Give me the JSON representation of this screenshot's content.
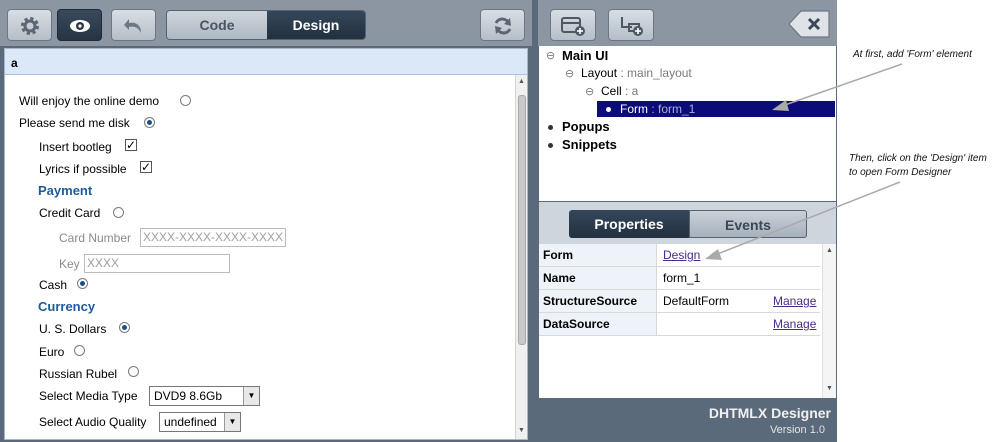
{
  "left_toolbar": {
    "tabs": {
      "code": "Code",
      "design": "Design"
    }
  },
  "cell": {
    "title": "a"
  },
  "form": {
    "enjoy_demo": "Will enjoy the online demo",
    "send_disk": "Please send me disk",
    "insert_bootleg": "Insert bootleg",
    "lyrics": "Lyrics if possible",
    "payment_header": "Payment",
    "credit_card": "Credit Card",
    "card_number_label": "Card Number",
    "card_number_placeholder": "XXXX-XXXX-XXXX-XXXX",
    "key_label": "Key",
    "key_placeholder": "XXXX",
    "cash": "Cash",
    "currency_header": "Currency",
    "usd": "U. S. Dollars",
    "euro": "Euro",
    "rubel": "Russian Rubel",
    "media_type_label": "Select Media Type",
    "media_type_value": "DVD9 8.6Gb",
    "audio_quality_label": "Select Audio Quality",
    "audio_quality_value": "undefined"
  },
  "tree": {
    "main_ui": "Main UI",
    "layout_label": "Layout",
    "layout_value": ": main_layout",
    "cell_label": "Cell",
    "cell_value": ": a",
    "form_label": "Form",
    "form_value": ": form_1",
    "popups": "Popups",
    "snippets": "Snippets"
  },
  "props_tabs": {
    "properties": "Properties",
    "events": "Events"
  },
  "properties": [
    {
      "name": "Form",
      "value": "Design",
      "manage": ""
    },
    {
      "name": "Name",
      "value": "form_1",
      "manage": ""
    },
    {
      "name": "StructureSource",
      "value": "DefaultForm",
      "manage": "Manage"
    },
    {
      "name": "DataSource",
      "value": "",
      "manage": "Manage"
    }
  ],
  "footer": {
    "title": "DHTMLX Designer",
    "version": "Version 1.0"
  },
  "annotations": {
    "note1": "At first, add 'Form' element",
    "note2_line1": "Then, click on the 'Design' item",
    "note2_line2": "to open Form Designer"
  },
  "colors": {
    "toolbar": "#8b96a2",
    "frame": "#5a6a7a",
    "selected": "#0b0b7a",
    "header_blue": "#1f5a9a"
  },
  "icons": [
    "gear-icon",
    "eye-icon",
    "undo-icon",
    "refresh-icon",
    "add-container-icon",
    "add-item-icon",
    "close-icon"
  ]
}
